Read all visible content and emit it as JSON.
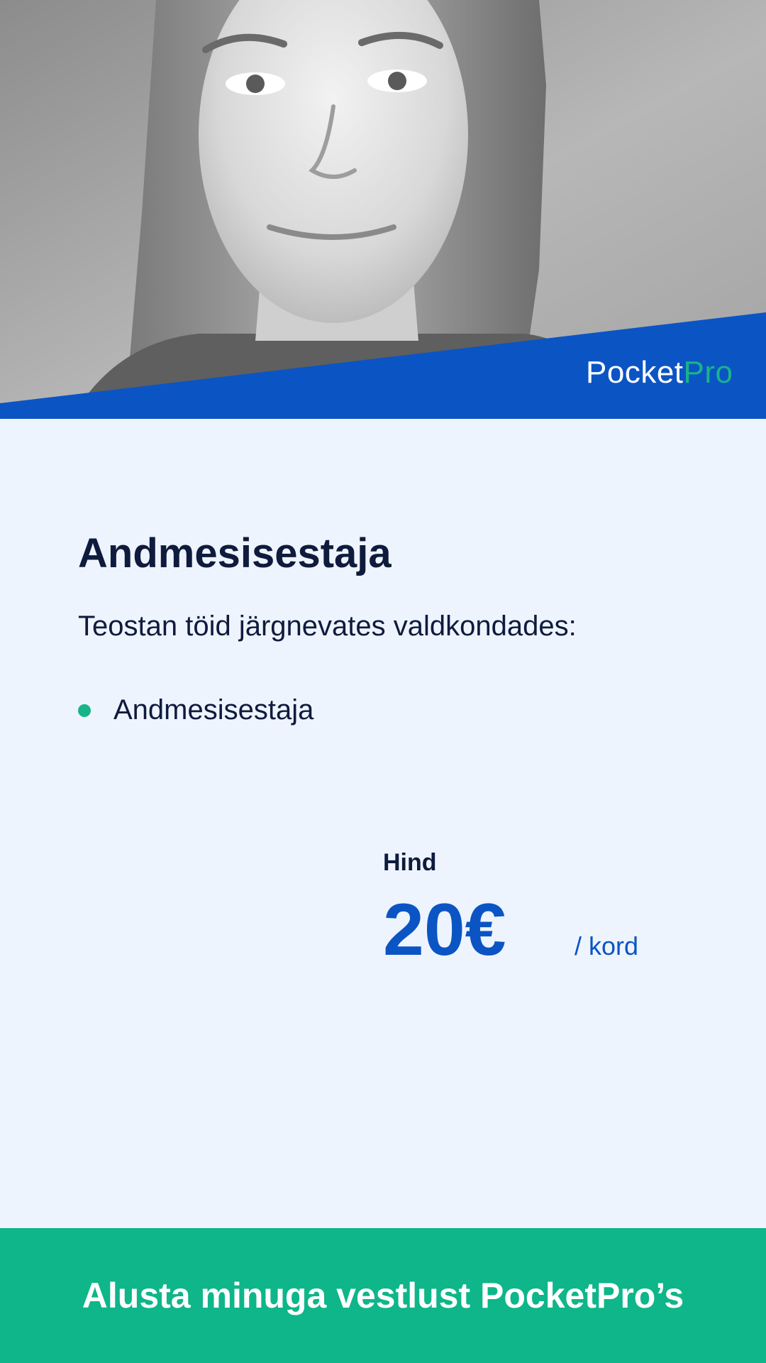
{
  "brand": {
    "name_main": "Pocket",
    "name_accent": "Pro",
    "primary_color": "#0B54C4",
    "accent_color": "#0EB68A"
  },
  "profile": {
    "title": "Andmesisestaja",
    "intro": "Teostan töid järgnevates valdkondades:",
    "skills": [
      "Andmesisestaja"
    ]
  },
  "price": {
    "label": "Hind",
    "value": "20€",
    "unit": "/ kord"
  },
  "cta": {
    "label": "Alusta minuga vestlust PocketPro’s"
  }
}
